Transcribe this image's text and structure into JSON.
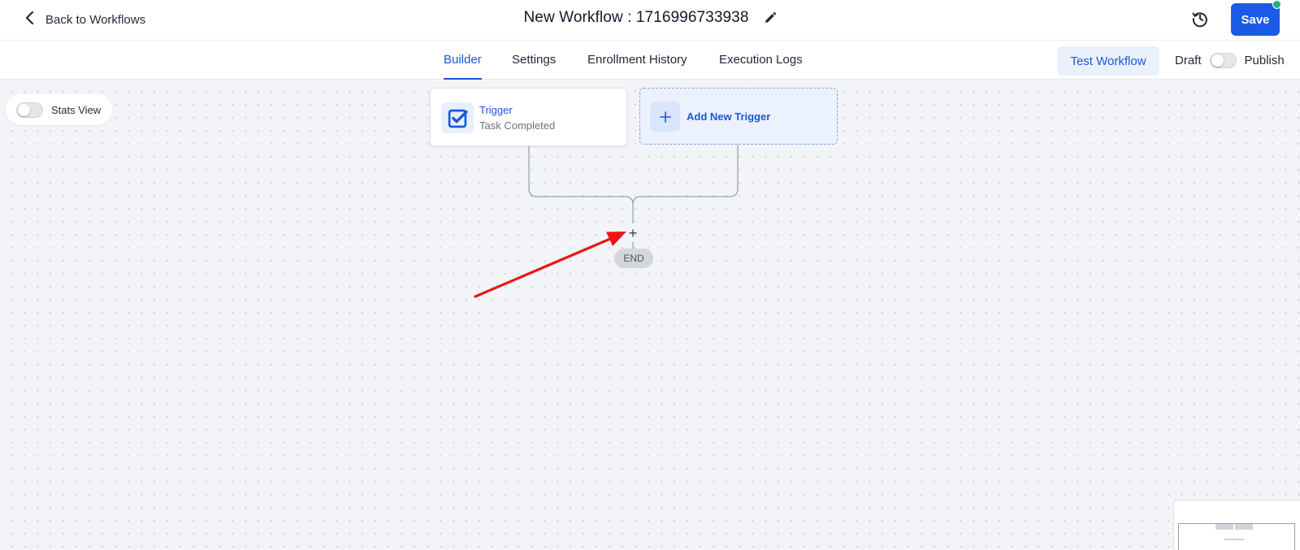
{
  "header": {
    "back_label": "Back to Workflows",
    "title": "New Workflow : 1716996733938",
    "save_label": "Save"
  },
  "tabs": [
    {
      "label": "Builder",
      "active": true
    },
    {
      "label": "Settings",
      "active": false
    },
    {
      "label": "Enrollment History",
      "active": false
    },
    {
      "label": "Execution Logs",
      "active": false
    }
  ],
  "actions": {
    "test_label": "Test Workflow",
    "draft_label": "Draft",
    "publish_label": "Publish",
    "publish_on": false
  },
  "canvas": {
    "stats_view_label": "Stats View",
    "stats_view_on": false,
    "trigger": {
      "label": "Trigger",
      "subtitle": "Task Completed"
    },
    "add_trigger_label": "Add New Trigger",
    "add_action_symbol": "+",
    "end_label": "END"
  },
  "colors": {
    "accent": "#1a56db",
    "save_bg": "#1a5ae6",
    "status_dot": "#10b981",
    "annotation_arrow": "#e81818"
  },
  "icons": {
    "back": "chevron-left-icon",
    "edit": "pencil-icon",
    "history": "history-icon",
    "trigger": "checkbox-icon",
    "add": "plus-icon"
  }
}
